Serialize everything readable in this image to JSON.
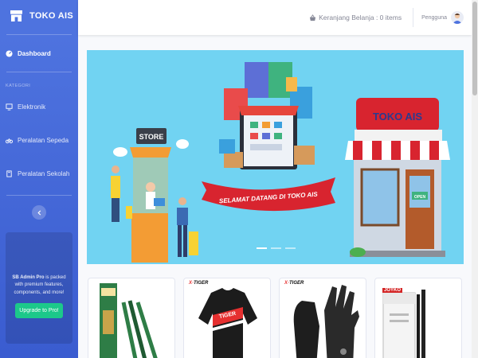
{
  "app": {
    "title": "TOKO AIS"
  },
  "sidebar": {
    "dashboard_label": "Dashboard",
    "heading": "KATEGORI",
    "items": [
      {
        "label": "Elektronik",
        "icon": "tv-icon"
      },
      {
        "label": "Peralatan Sepeda",
        "icon": "bicycle-icon"
      },
      {
        "label": "Peralatan Sekolah",
        "icon": "book-icon"
      }
    ],
    "promo": {
      "text_bold": "SB Admin Pro",
      "text_rest": " is packed with premium features, components, and more!",
      "button_label": "Upgrade to Pro!"
    }
  },
  "topbar": {
    "cart_label": "Keranjang Belanja : 0 items",
    "user_label": "Pengguna"
  },
  "banner": {
    "store_sign": "STORE",
    "shop_sign": "TOKO AIS",
    "ribbon": "SELAMAT DATANG DI TOKO AIS",
    "open_sign": "OPEN"
  },
  "products": [
    {
      "brand": "",
      "name": "pencil-set"
    },
    {
      "brand": "TIGER",
      "name": "cycling-jersey"
    },
    {
      "brand": "TIGER",
      "name": "cycling-gloves"
    },
    {
      "brand": "JOYKO",
      "name": "ballpoint-pen"
    }
  ],
  "colors": {
    "sidebar": "#4e73df",
    "banner_bg": "#71d3f2",
    "upgrade": "#1cc88a",
    "awning_red": "#d8242f"
  }
}
